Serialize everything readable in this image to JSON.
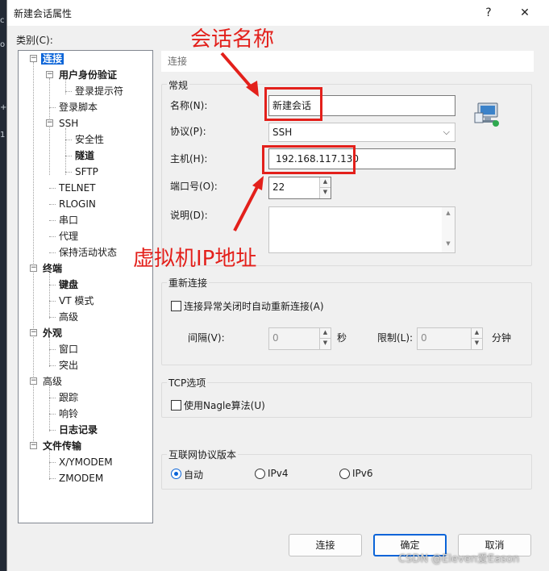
{
  "desktop": {
    "left_chars": [
      "c",
      "o",
      "+",
      "1"
    ]
  },
  "window": {
    "title": "新建会话属性",
    "help_btn": "?",
    "close_btn": "✕"
  },
  "category_label": "类别(C):",
  "tree": {
    "connection": "连接",
    "auth": "用户身份验证",
    "login_prompt": "登录提示符",
    "login_script": "登录脚本",
    "ssh": "SSH",
    "security": "安全性",
    "tunnel": "隧道",
    "sftp": "SFTP",
    "telnet": "TELNET",
    "rlogin": "RLOGIN",
    "serial": "串口",
    "proxy": "代理",
    "keepalive": "保持活动状态",
    "terminal": "终端",
    "keyboard": "键盘",
    "vt_mode": "VT 模式",
    "advanced1": "高级",
    "appearance": "外观",
    "window": "窗口",
    "highlight": "突出",
    "advanced": "高级",
    "trace": "跟踪",
    "bell": "响铃",
    "logging": "日志记录",
    "file_transfer": "文件传输",
    "xymodem": "X/YMODEM",
    "zmodem": "ZMODEM"
  },
  "pane_header": "连接",
  "general": {
    "legend": "常规",
    "name_label": "名称(N):",
    "name_value": "新建会话",
    "protocol_label": "协议(P):",
    "protocol_value": "SSH",
    "host_label": "主机(H):",
    "host_value": "192.168.117.130",
    "port_label": "端口号(O):",
    "port_value": "22",
    "desc_label": "说明(D):",
    "desc_value": ""
  },
  "reconnect": {
    "legend": "重新连接",
    "checkbox_label": "连接异常关闭时自动重新连接(A)",
    "interval_label": "间隔(V):",
    "interval_value": "0",
    "interval_unit": "秒",
    "limit_label": "限制(L):",
    "limit_value": "0",
    "limit_unit": "分钟"
  },
  "tcp": {
    "legend": "TCP选项",
    "nagle_label": "使用Nagle算法(U)"
  },
  "ip_version": {
    "legend": "互联网协议版本",
    "options": [
      "自动",
      "IPv4",
      "IPv6"
    ],
    "selected": "自动"
  },
  "buttons": {
    "connect": "连接",
    "ok": "确定",
    "cancel": "取消"
  },
  "annotations": {
    "session_name": "会话名称",
    "host_ip": "虚拟机IP地址",
    "color": "#e3201b"
  },
  "watermark": "CSDN @Eleven爱Eason"
}
